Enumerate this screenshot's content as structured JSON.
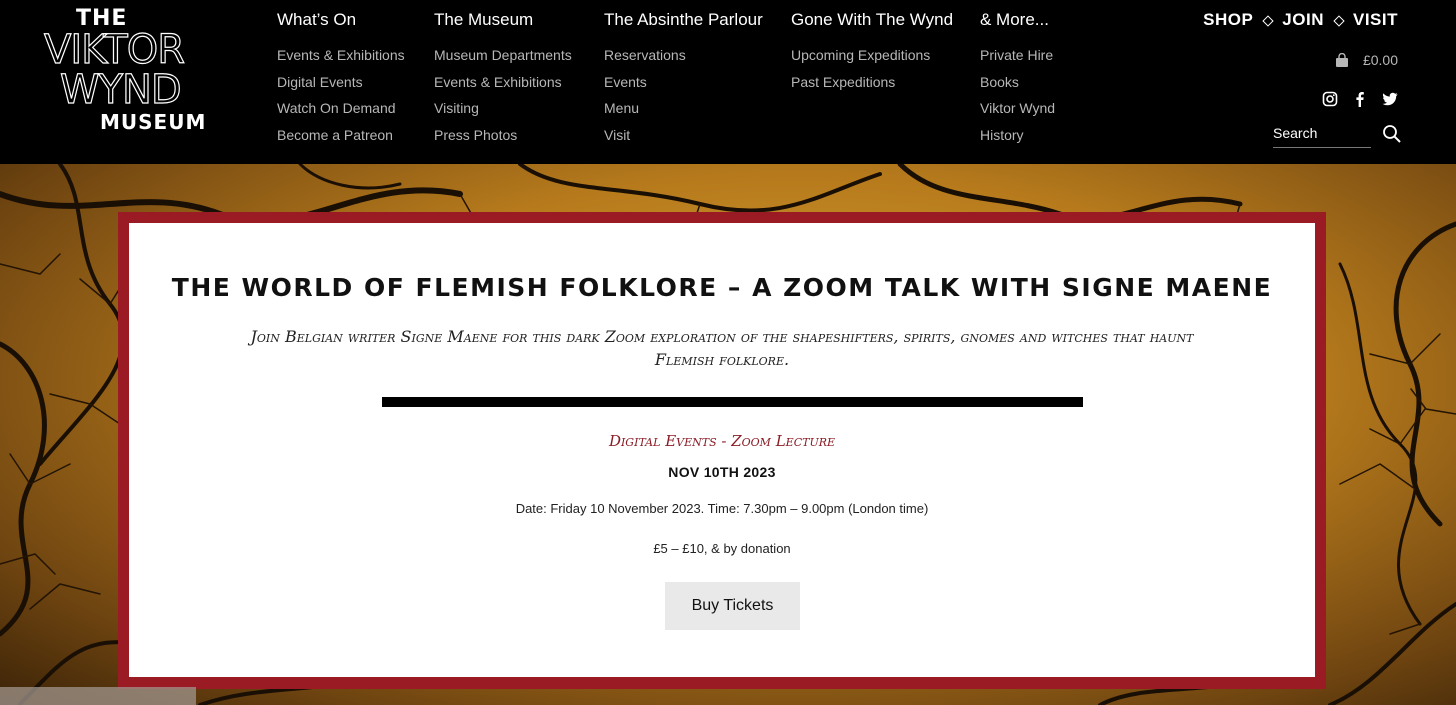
{
  "logo": {
    "line1": "THE",
    "line2": "VIKTOR",
    "line3": "WYND",
    "line4": "MUSEUM"
  },
  "nav": [
    {
      "label": "What’s On",
      "items": [
        "Events & Exhibitions",
        "Digital Events",
        "Watch On Demand",
        "Become a Patreon"
      ]
    },
    {
      "label": "The Museum",
      "items": [
        "Museum Departments",
        "Events & Exhibitions",
        "Visiting",
        "Press Photos"
      ]
    },
    {
      "label": "The Absinthe Parlour",
      "items": [
        "Reservations",
        "Events",
        "Menu",
        "Visit"
      ]
    },
    {
      "label": "Gone With The Wynd",
      "items": [
        "Upcoming Expeditions",
        "Past Expeditions"
      ]
    },
    {
      "label": "& More...",
      "items": [
        "Private Hire",
        "Books",
        "Viktor Wynd",
        "History"
      ]
    }
  ],
  "top_links": {
    "shop": "SHOP",
    "join": "JOIN",
    "visit": "VISIT"
  },
  "cart": {
    "total": "£0.00",
    "icon": "shopping-bag-icon"
  },
  "social": [
    "instagram-icon",
    "facebook-icon",
    "twitter-icon"
  ],
  "search": {
    "placeholder": "Search",
    "value": ""
  },
  "event": {
    "title": "THE WORLD OF FLEMISH FOLKLORE – A ZOOM TALK WITH SIGNE MAENE",
    "subtitle": "Join Belgian writer Signe Maene for this dark Zoom exploration of the shapeshifters, spirits, gnomes and witches that haunt Flemish folklore.",
    "category": "Digital Events - Zoom Lecture",
    "date": "NOV 10TH 2023",
    "date_line": "Date: Friday 10 November 2023. Time: 7.30pm – 9.00pm (London time)",
    "price": "£5 – £10, & by donation",
    "buy_label": "Buy Tickets"
  },
  "colors": {
    "accent": "#9b1b24",
    "header_bg": "#000000",
    "nav_sub": "#b7b7b7"
  }
}
